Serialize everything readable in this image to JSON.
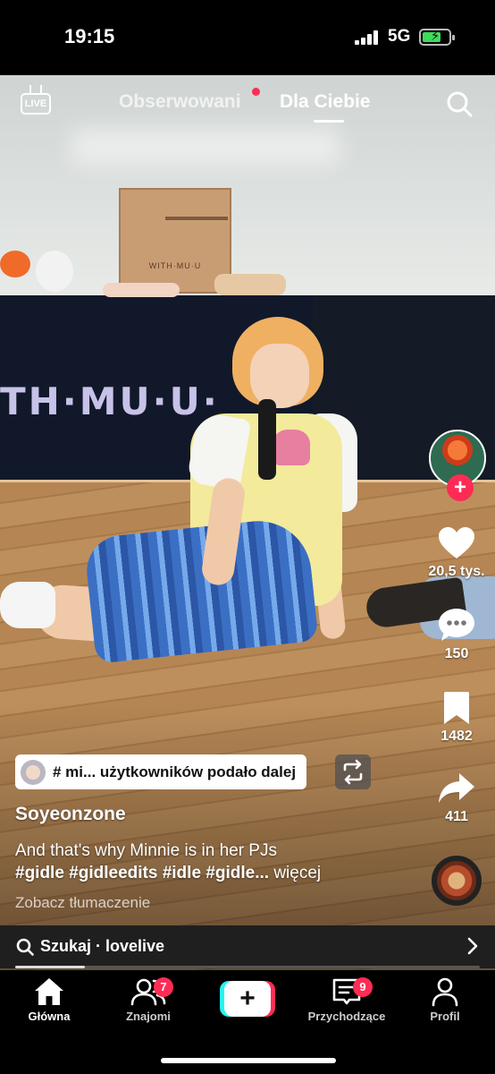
{
  "status_bar": {
    "time": "19:15",
    "network": "5G",
    "battery_level": 0.7,
    "battery_charging": true
  },
  "top_nav": {
    "live_label": "LIVE",
    "tabs": [
      {
        "label": "Obserwowani",
        "active": false,
        "has_dot": true
      },
      {
        "label": "Dla Ciebie",
        "active": true
      }
    ]
  },
  "video": {
    "banner_text": "TH·MU·U·",
    "box_label": "WITH·MU·U"
  },
  "right_rail": {
    "like_count": "20,5 tys.",
    "comment_count": "150",
    "bookmark_count": "1482",
    "share_count": "411"
  },
  "repost": {
    "text": "# mi... użytkowników podało dalej"
  },
  "post": {
    "username": "Soyeonzone",
    "caption_line1": "And that's why Minnie is in her PJs",
    "caption_line2": "#gidle #gidleedits #idle #gidle...",
    "more_label": "więcej",
    "translate_label": "Zobacz tłumaczenie",
    "progress": 0.15
  },
  "search_suggestion": {
    "text": "Szukaj · lovelive"
  },
  "bottom_nav": {
    "items": [
      {
        "label": "Główna",
        "icon": "home-icon",
        "active": true
      },
      {
        "label": "Znajomi",
        "icon": "friends-icon",
        "badge": "7"
      },
      {
        "label": "",
        "icon": "create-plus-icon"
      },
      {
        "label": "Przychodzące",
        "icon": "inbox-icon",
        "badge": "9"
      },
      {
        "label": "Profil",
        "icon": "profile-icon"
      }
    ]
  },
  "colors": {
    "accent_red": "#fe2c55",
    "accent_cyan": "#25f4ee"
  }
}
